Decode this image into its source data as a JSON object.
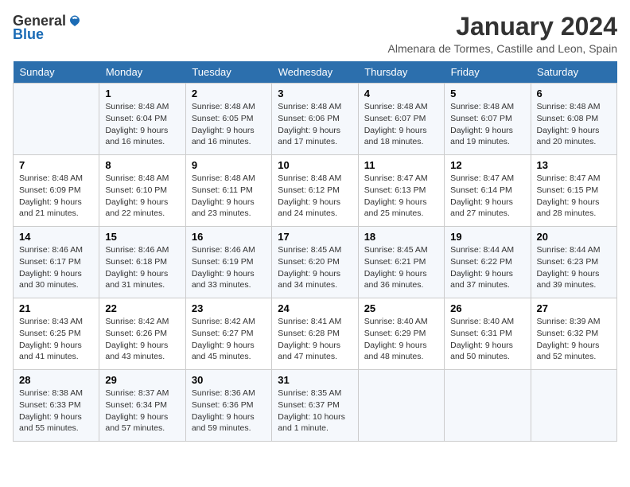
{
  "header": {
    "logo_general": "General",
    "logo_blue": "Blue",
    "month": "January 2024",
    "location": "Almenara de Tormes, Castille and Leon, Spain"
  },
  "days_of_week": [
    "Sunday",
    "Monday",
    "Tuesday",
    "Wednesday",
    "Thursday",
    "Friday",
    "Saturday"
  ],
  "weeks": [
    [
      {
        "day": "",
        "info": ""
      },
      {
        "day": "1",
        "info": "Sunrise: 8:48 AM\nSunset: 6:04 PM\nDaylight: 9 hours and 16 minutes."
      },
      {
        "day": "2",
        "info": "Sunrise: 8:48 AM\nSunset: 6:05 PM\nDaylight: 9 hours and 16 minutes."
      },
      {
        "day": "3",
        "info": "Sunrise: 8:48 AM\nSunset: 6:06 PM\nDaylight: 9 hours and 17 minutes."
      },
      {
        "day": "4",
        "info": "Sunrise: 8:48 AM\nSunset: 6:07 PM\nDaylight: 9 hours and 18 minutes."
      },
      {
        "day": "5",
        "info": "Sunrise: 8:48 AM\nSunset: 6:07 PM\nDaylight: 9 hours and 19 minutes."
      },
      {
        "day": "6",
        "info": "Sunrise: 8:48 AM\nSunset: 6:08 PM\nDaylight: 9 hours and 20 minutes."
      }
    ],
    [
      {
        "day": "7",
        "info": "Sunrise: 8:48 AM\nSunset: 6:09 PM\nDaylight: 9 hours and 21 minutes."
      },
      {
        "day": "8",
        "info": "Sunrise: 8:48 AM\nSunset: 6:10 PM\nDaylight: 9 hours and 22 minutes."
      },
      {
        "day": "9",
        "info": "Sunrise: 8:48 AM\nSunset: 6:11 PM\nDaylight: 9 hours and 23 minutes."
      },
      {
        "day": "10",
        "info": "Sunrise: 8:48 AM\nSunset: 6:12 PM\nDaylight: 9 hours and 24 minutes."
      },
      {
        "day": "11",
        "info": "Sunrise: 8:47 AM\nSunset: 6:13 PM\nDaylight: 9 hours and 25 minutes."
      },
      {
        "day": "12",
        "info": "Sunrise: 8:47 AM\nSunset: 6:14 PM\nDaylight: 9 hours and 27 minutes."
      },
      {
        "day": "13",
        "info": "Sunrise: 8:47 AM\nSunset: 6:15 PM\nDaylight: 9 hours and 28 minutes."
      }
    ],
    [
      {
        "day": "14",
        "info": "Sunrise: 8:46 AM\nSunset: 6:17 PM\nDaylight: 9 hours and 30 minutes."
      },
      {
        "day": "15",
        "info": "Sunrise: 8:46 AM\nSunset: 6:18 PM\nDaylight: 9 hours and 31 minutes."
      },
      {
        "day": "16",
        "info": "Sunrise: 8:46 AM\nSunset: 6:19 PM\nDaylight: 9 hours and 33 minutes."
      },
      {
        "day": "17",
        "info": "Sunrise: 8:45 AM\nSunset: 6:20 PM\nDaylight: 9 hours and 34 minutes."
      },
      {
        "day": "18",
        "info": "Sunrise: 8:45 AM\nSunset: 6:21 PM\nDaylight: 9 hours and 36 minutes."
      },
      {
        "day": "19",
        "info": "Sunrise: 8:44 AM\nSunset: 6:22 PM\nDaylight: 9 hours and 37 minutes."
      },
      {
        "day": "20",
        "info": "Sunrise: 8:44 AM\nSunset: 6:23 PM\nDaylight: 9 hours and 39 minutes."
      }
    ],
    [
      {
        "day": "21",
        "info": "Sunrise: 8:43 AM\nSunset: 6:25 PM\nDaylight: 9 hours and 41 minutes."
      },
      {
        "day": "22",
        "info": "Sunrise: 8:42 AM\nSunset: 6:26 PM\nDaylight: 9 hours and 43 minutes."
      },
      {
        "day": "23",
        "info": "Sunrise: 8:42 AM\nSunset: 6:27 PM\nDaylight: 9 hours and 45 minutes."
      },
      {
        "day": "24",
        "info": "Sunrise: 8:41 AM\nSunset: 6:28 PM\nDaylight: 9 hours and 47 minutes."
      },
      {
        "day": "25",
        "info": "Sunrise: 8:40 AM\nSunset: 6:29 PM\nDaylight: 9 hours and 48 minutes."
      },
      {
        "day": "26",
        "info": "Sunrise: 8:40 AM\nSunset: 6:31 PM\nDaylight: 9 hours and 50 minutes."
      },
      {
        "day": "27",
        "info": "Sunrise: 8:39 AM\nSunset: 6:32 PM\nDaylight: 9 hours and 52 minutes."
      }
    ],
    [
      {
        "day": "28",
        "info": "Sunrise: 8:38 AM\nSunset: 6:33 PM\nDaylight: 9 hours and 55 minutes."
      },
      {
        "day": "29",
        "info": "Sunrise: 8:37 AM\nSunset: 6:34 PM\nDaylight: 9 hours and 57 minutes."
      },
      {
        "day": "30",
        "info": "Sunrise: 8:36 AM\nSunset: 6:36 PM\nDaylight: 9 hours and 59 minutes."
      },
      {
        "day": "31",
        "info": "Sunrise: 8:35 AM\nSunset: 6:37 PM\nDaylight: 10 hours and 1 minute."
      },
      {
        "day": "",
        "info": ""
      },
      {
        "day": "",
        "info": ""
      },
      {
        "day": "",
        "info": ""
      }
    ]
  ]
}
